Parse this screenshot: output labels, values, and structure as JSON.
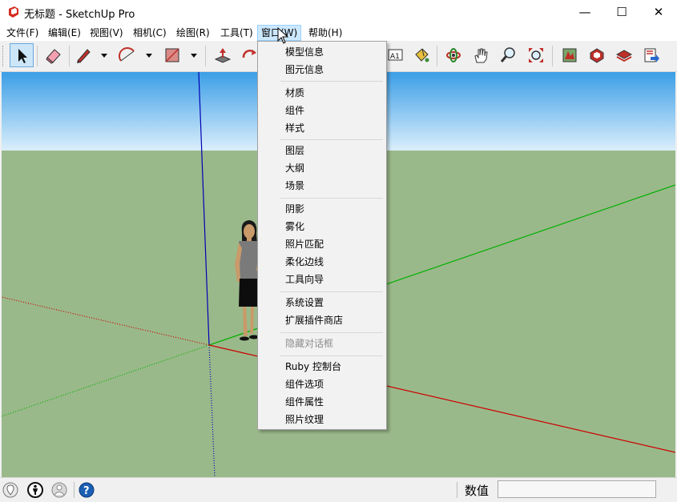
{
  "window": {
    "title": "无标题 - SketchUp Pro",
    "minimize": "—",
    "maximize": "☐",
    "close": "✕"
  },
  "menubar": {
    "items": [
      {
        "label": "文件(F)"
      },
      {
        "label": "编辑(E)"
      },
      {
        "label": "视图(V)"
      },
      {
        "label": "相机(C)"
      },
      {
        "label": "绘图(R)"
      },
      {
        "label": "工具(T)"
      },
      {
        "label": "窗口(W)"
      },
      {
        "label": "帮助(H)"
      }
    ],
    "active": "窗口(W)"
  },
  "window_menu": {
    "items": [
      {
        "label": "模型信息",
        "enabled": true
      },
      {
        "label": "图元信息",
        "enabled": true
      },
      {
        "label": "材质",
        "enabled": true
      },
      {
        "label": "组件",
        "enabled": true
      },
      {
        "label": "样式",
        "enabled": true
      },
      {
        "label": "图层",
        "enabled": true
      },
      {
        "label": "大纲",
        "enabled": true
      },
      {
        "label": "场景",
        "enabled": true
      },
      {
        "label": "阴影",
        "enabled": true
      },
      {
        "label": "雾化",
        "enabled": true
      },
      {
        "label": "照片匹配",
        "enabled": true
      },
      {
        "label": "柔化边线",
        "enabled": true
      },
      {
        "label": "工具向导",
        "enabled": true
      },
      {
        "label": "系统设置",
        "enabled": true
      },
      {
        "label": "扩展插件商店",
        "enabled": true
      },
      {
        "label": "隐藏对话框",
        "enabled": false
      },
      {
        "label": "Ruby 控制台",
        "enabled": true
      },
      {
        "label": "组件选项",
        "enabled": true
      },
      {
        "label": "组件属性",
        "enabled": true
      },
      {
        "label": "照片纹理",
        "enabled": true
      }
    ]
  },
  "toolbar": {
    "tools": [
      "select-icon",
      "eraser-icon",
      "pencil-icon",
      "arc-icon",
      "rectangle-icon",
      "push-pull-icon",
      "move-icon",
      "text-icon",
      "paint-bucket-icon",
      "orbit-icon",
      "pan-icon",
      "zoom-icon",
      "zoom-extents-icon",
      "warehouse-icon",
      "extension-warehouse-icon",
      "layout-icon",
      "send-to-layout-icon"
    ],
    "text_tool_label": "A1"
  },
  "statusbar": {
    "measurements_label": "数值",
    "measurements_value": ""
  },
  "colors": {
    "sky_top": "#3b9ee6",
    "sky_bottom": "#dbeffc",
    "ground": "#9ab98a",
    "axis_red": "#cc0000",
    "axis_green": "#00b000",
    "axis_blue": "#0000b4",
    "menu_highlight": "#cce8ff"
  }
}
